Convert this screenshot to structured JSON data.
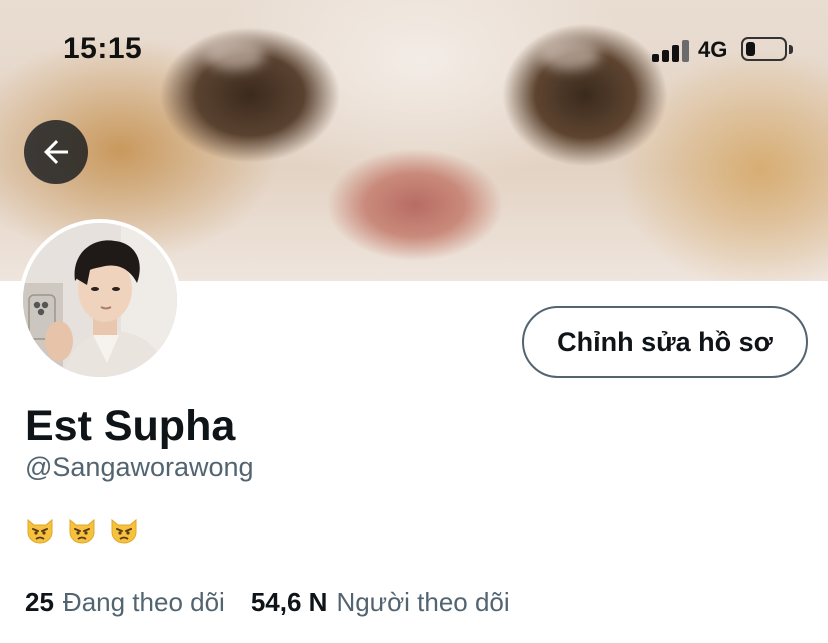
{
  "status_bar": {
    "time": "15:15",
    "network": "4G"
  },
  "profile": {
    "display_name": "Est Supha",
    "username": "@Sangaworawong",
    "bio_emojis": [
      "pouting-cat-emoji",
      "pouting-cat-emoji",
      "pouting-cat-emoji"
    ],
    "edit_button_label": "Chỉnh sửa hồ sơ"
  },
  "stats": {
    "following_count": "25",
    "following_label": "Đang theo dõi",
    "followers_count": "54,6 N",
    "followers_label": "Người theo dõi"
  },
  "icons": {
    "back": "arrow-left-icon",
    "signal": "cellular-signal-icon",
    "battery": "battery-icon"
  },
  "colors": {
    "primary_text": "#0f1419",
    "secondary_text": "#536471",
    "button_border": "#536471"
  }
}
